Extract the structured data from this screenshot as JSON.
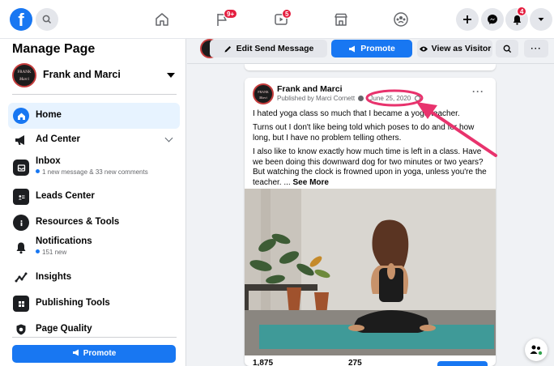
{
  "topbar": {
    "logo": "f",
    "icons": [
      "facebook-logo",
      "search-icon",
      "home-icon",
      "pages-flag-icon",
      "watch-icon",
      "marketplace-icon",
      "groups-icon",
      "create-plus-icon",
      "messenger-icon",
      "notifications-bell-icon",
      "account-caret-icon"
    ],
    "pages_badge": "9+",
    "watch_badge": "5",
    "notifications_badge": "4"
  },
  "sidebar": {
    "title": "Manage Page",
    "page_name": "Frank and Marci",
    "avatar_text": "FRANK",
    "avatar_script": "Marci",
    "items": [
      {
        "label": "Home",
        "icon": "home-icon"
      },
      {
        "label": "Ad Center",
        "icon": "megaphone-icon"
      },
      {
        "label": "Inbox",
        "sub": "1 new message & 33 new comments",
        "icon": "inbox-icon"
      },
      {
        "label": "Leads Center",
        "icon": "leads-icon"
      },
      {
        "label": "Resources & Tools",
        "icon": "info-icon"
      },
      {
        "label": "Notifications",
        "sub": "151 new",
        "icon": "bell-icon"
      },
      {
        "label": "Insights",
        "icon": "insights-icon"
      },
      {
        "label": "Publishing Tools",
        "icon": "publishing-icon"
      },
      {
        "label": "Page Quality",
        "icon": "shield-icon"
      }
    ],
    "promote_label": "Promote"
  },
  "actionbar": {
    "edit_send_message": "Edit Send Message",
    "promote": "Promote",
    "view_as_visitor": "View as Visitor"
  },
  "post": {
    "author": "Frank and Marci",
    "published_by": "Published by Marci Cornett",
    "date": "June 25, 2020",
    "more": "···",
    "paragraphs": [
      "I hated yoga class so much that I became a yoga teacher.",
      "Turns out I don't like being told which poses to do and for how long, but I have no problem telling others.",
      "I also like to know exactly how much time is left in a class. Have we been doing this downward dog for two minutes or two years? But watching the clock is frowned upon in yoga, unless you're the teacher."
    ],
    "ellipsis": " ... ",
    "see_more": "See More",
    "reach": "1,875",
    "engagements": "275"
  },
  "colors": {
    "brand": "#1877f2",
    "badge": "#e41e3f",
    "highlight": "#e8336d"
  }
}
